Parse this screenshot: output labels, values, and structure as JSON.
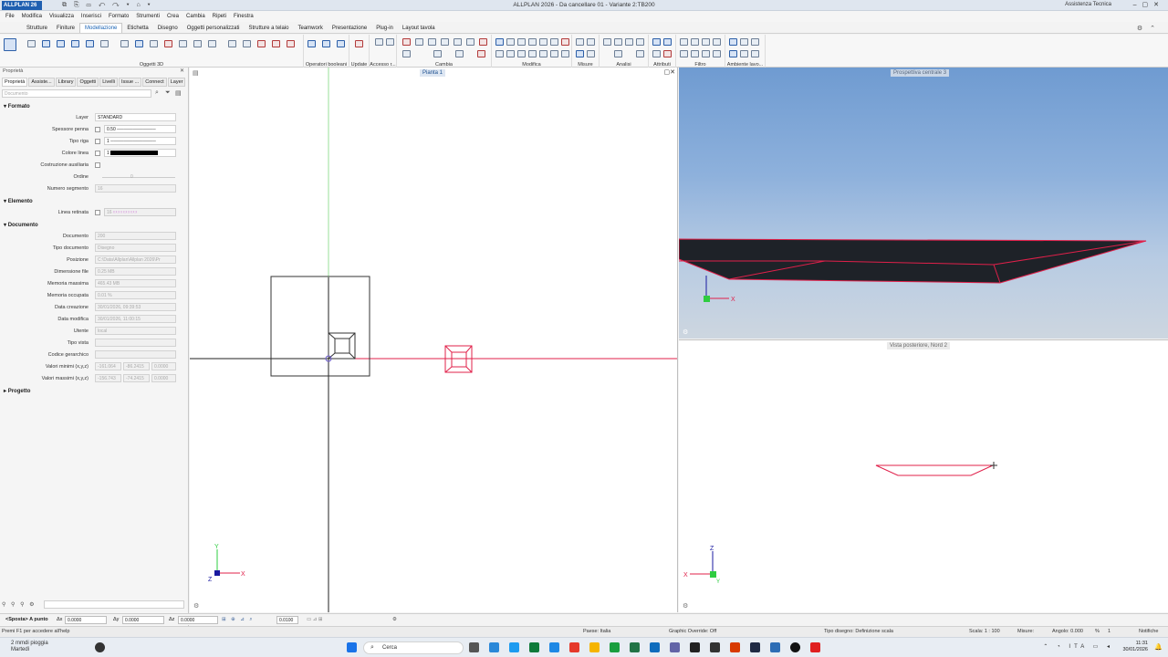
{
  "titlebar": {
    "app_badge": "ALLPLAN 26",
    "window_title": "ALLPLAN 2026 - Da cancellare 01 - Variante 2:TB200",
    "help": "Assistenza Tecnica"
  },
  "menu": [
    "File",
    "Modifica",
    "Visualizza",
    "Inserisci",
    "Formato",
    "Strumenti",
    "Crea",
    "Cambia",
    "Ripeti",
    "Finestra"
  ],
  "ribbon_tabs": [
    "Strutture",
    "Finiture",
    "Modellazione",
    "Etichetta",
    "Disegno",
    "Oggetti personalizzati",
    "Strutture a telaio",
    "Teamwork",
    "Presentazione",
    "Plug-in",
    "Layout tavola"
  ],
  "ribbon_groups": [
    "Oggetti 3D",
    "Operatori booleani",
    "Update",
    "Accesso r...",
    "Cambia",
    "Modifica",
    "Misure",
    "Analisi",
    "Attributi",
    "Filtro",
    "Ambiente lavo..."
  ],
  "left_panel": {
    "title": "Proprietà",
    "tabs": [
      "Proprietà",
      "Assiste...",
      "Library",
      "Oggetti",
      "Livelli",
      "Issue ...",
      "Connect",
      "Layer"
    ],
    "search_placeholder": "Documento",
    "sections": {
      "formato": "Formato",
      "elemento": "Elemento",
      "documento": "Documento",
      "progetto": "Progetto"
    },
    "formato": {
      "layer_label": "Layer",
      "layer_value": "STANDARD",
      "pen_label": "Spessore penna",
      "pen_value": "0.50",
      "line_label": "Tipo riga",
      "line_value": "1",
      "color_label": "Colore linea",
      "color_value": "1",
      "aux_label": "Costruzione ausiliaria",
      "order_label": "Ordine",
      "order_value": "0",
      "segments_label": "Numero segmento",
      "segments_value": "16"
    },
    "elemento": {
      "hatch_label": "Linea retinata",
      "hatch_value": "16"
    },
    "documento": [
      {
        "label": "Documento",
        "value": "200"
      },
      {
        "label": "Tipo documento",
        "value": "Disegno"
      },
      {
        "label": "Posizione",
        "value": "C:\\Data\\Allplan\\Allplan 2026\\Pr"
      },
      {
        "label": "Dimensione file",
        "value": "0.25 MB"
      },
      {
        "label": "Memoria massima",
        "value": "465.43 MB"
      },
      {
        "label": "Memoria occupata",
        "value": "0.01 %"
      },
      {
        "label": "Data creazione",
        "value": "30/01/2026, 09:39:53"
      },
      {
        "label": "Data modifica",
        "value": "30/01/2026, 11:00:15"
      },
      {
        "label": "Utente",
        "value": "local"
      },
      {
        "label": "Tipo vista",
        "value": ""
      },
      {
        "label": "Codice gerarchico",
        "value": ""
      }
    ],
    "min_label": "Valori minimi (x,y,z)",
    "min_values": [
      "-161.064",
      "-86.2415",
      "0.0000"
    ],
    "max_label": "Valori massimi (x,y,z)",
    "max_values": [
      "-156.743",
      "-74.2415",
      "0.0000"
    ]
  },
  "viewports": {
    "plan": "Pianta 1",
    "perspective": "Prospettiva centrale 3",
    "north": "Vista posteriore, Nord 2"
  },
  "coordbar": {
    "prompt": "<Sposta> A punto",
    "dx_label": "Δx",
    "dx": "0.0000",
    "dy_label": "Δy",
    "dy": "0.0000",
    "dz_label": "Δz",
    "dz": "0.0000",
    "step": "0.0100"
  },
  "statusbar": {
    "hint": "Premi F1 per accedere all'help",
    "country": "Paese:  Italia",
    "override": "Graphic Override:  Off",
    "drawing_type": "Tipo disegno:  Definizione scala",
    "scale": "Scala:  1 : 100",
    "units": "Misure:",
    "angle": "Angolo:  0.000",
    "percent": "%",
    "percent_value": "1",
    "notifications": "Notifiche"
  },
  "taskbar": {
    "weather_line1": "2 mmdi pioggia",
    "weather_line2": "Martedì",
    "search": "Cerca",
    "lang": "ITA",
    "time": "11:31",
    "date": "30/01/2026"
  },
  "colors": {
    "accent": "#1b64b5",
    "selection_red": "#e0204a",
    "axis_green": "#2ecc40"
  }
}
